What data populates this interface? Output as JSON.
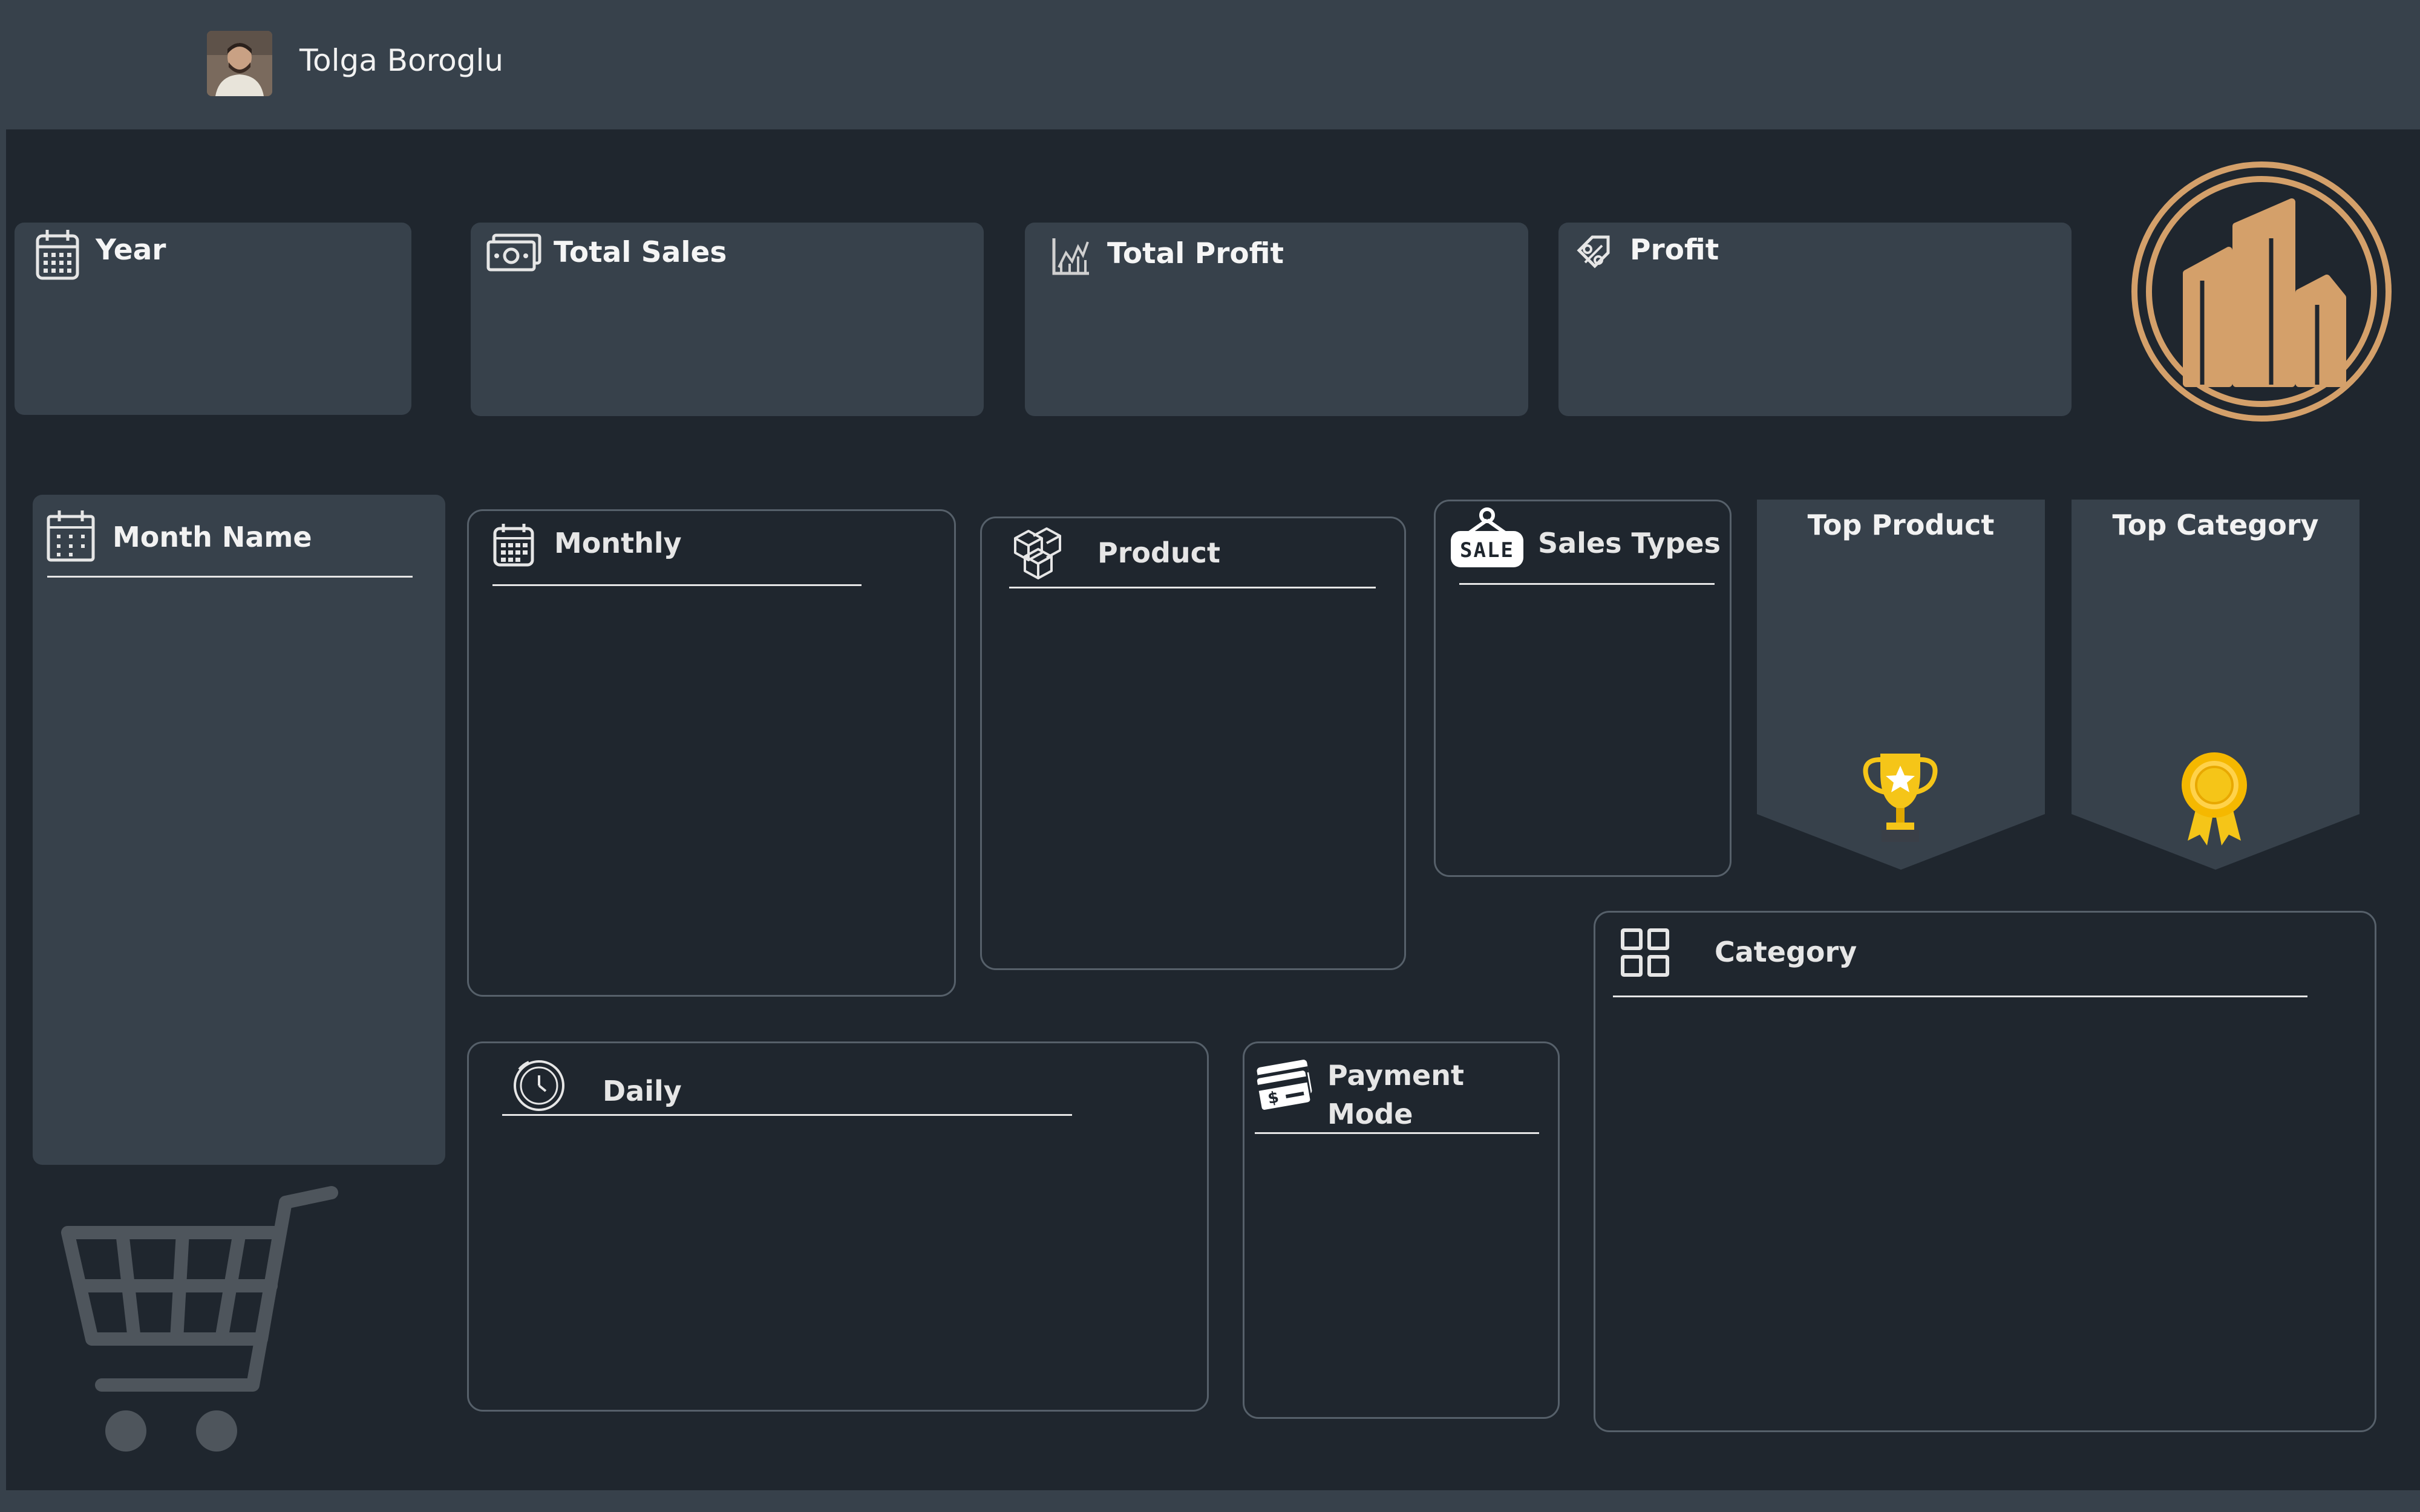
{
  "header": {
    "user_name": "Tolga Boroglu"
  },
  "kpis": {
    "year_label": "Year",
    "total_sales_label": "Total Sales",
    "total_profit_label": "Total Profit",
    "profit_label": "Profit"
  },
  "panels": {
    "month_name": "Month Name",
    "monthly": "Monthly",
    "product": "Product",
    "sales_types": "Sales Types",
    "top_product": "Top Product",
    "top_category": "Top Category",
    "category": "Category",
    "daily": "Daily",
    "payment_mode_line1": "Payment",
    "payment_mode_line2": "Mode"
  },
  "icons": {
    "sale_tag_text": "SALE",
    "logo": "building-logo-icon",
    "trophy": "trophy-icon",
    "ribbon": "award-ribbon-icon",
    "cart": "shopping-cart-icon"
  },
  "colors": {
    "background": "#1f262e",
    "card": "#37414b",
    "accent_gold": "#d4a06a",
    "trophy": "#f5c518"
  }
}
